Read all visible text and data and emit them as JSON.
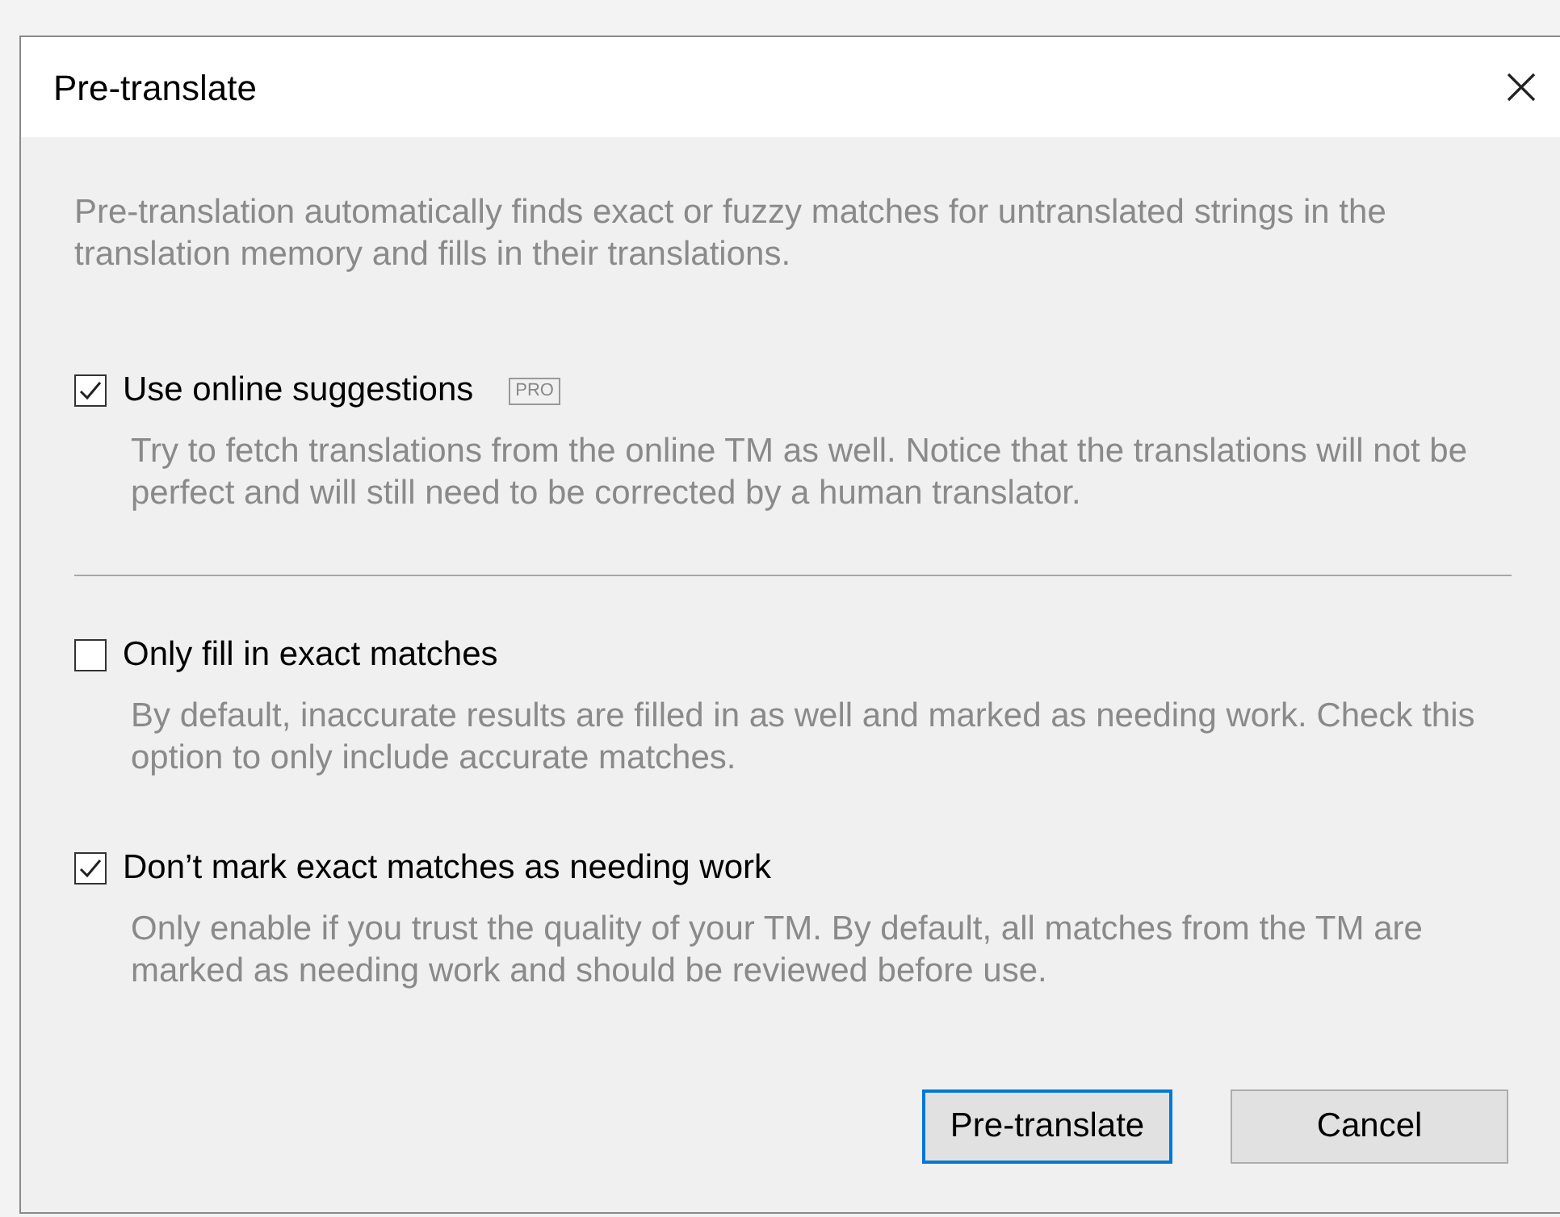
{
  "dialog": {
    "title": "Pre-translate",
    "intro": "Pre-translation automatically finds exact or fuzzy matches for untranslated strings in the translation memory and fills in their translations.",
    "options": [
      {
        "label": "Use online suggestions",
        "badge": "PRO",
        "checked": true,
        "description": "Try to fetch translations from the online TM as well. Notice that the translations will not be perfect and will still need to be corrected by a human translator."
      },
      {
        "label": "Only fill in exact matches",
        "checked": false,
        "description": "By default, inaccurate results are filled in as well and marked as needing work. Check this option to only include accurate matches."
      },
      {
        "label": "Don’t mark exact matches as needing work",
        "checked": true,
        "description": "Only enable if you trust the quality of your TM. By default, all matches from the TM are marked as needing work and should be reviewed before use."
      }
    ],
    "buttons": [
      {
        "label": "Pre-translate",
        "default": true
      },
      {
        "label": "Cancel",
        "default": false
      }
    ]
  }
}
